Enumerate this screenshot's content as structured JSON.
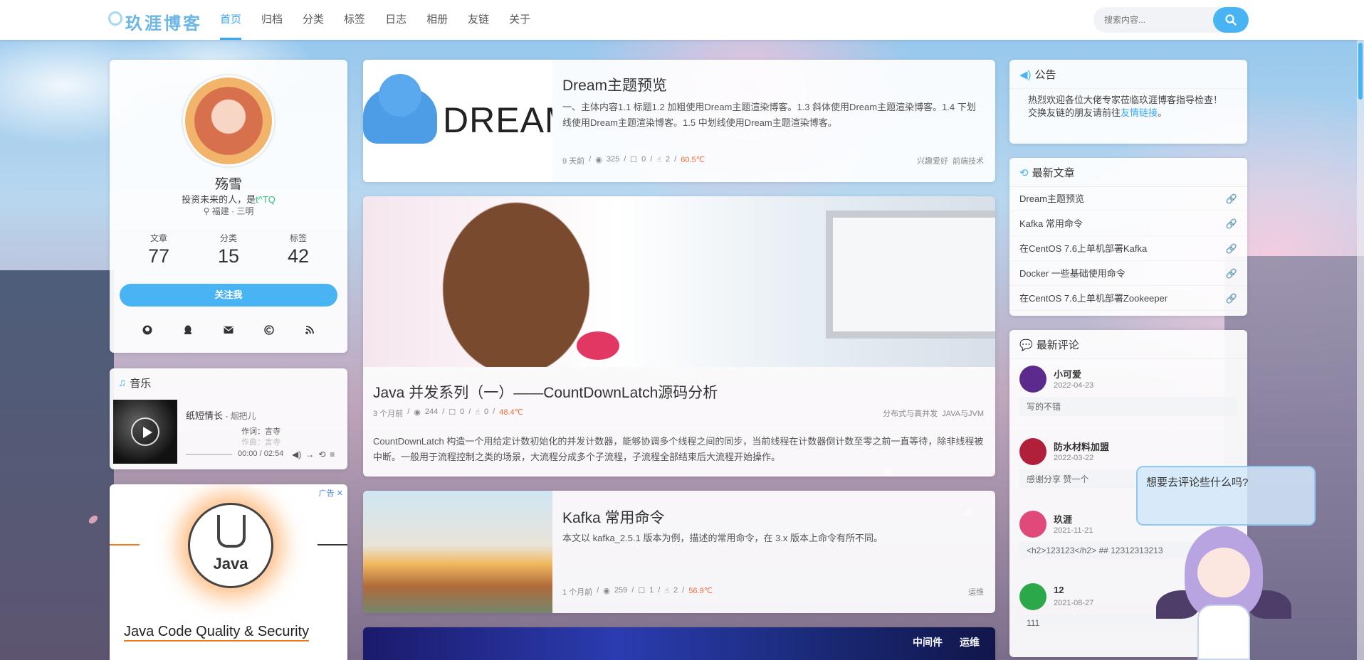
{
  "nav": {
    "logo": "玖涯博客",
    "items": [
      "首页",
      "归档",
      "分类",
      "标签",
      "日志",
      "相册",
      "友链",
      "关于"
    ],
    "active_index": 0,
    "search_placeholder": "搜索内容..."
  },
  "profile": {
    "name": "殇雪",
    "motto_prefix": "投资未来的人，是",
    "motto_highlight": "t^TQ",
    "location": "福建 · 三明",
    "stats": [
      {
        "label": "文章",
        "value": "77"
      },
      {
        "label": "分类",
        "value": "15"
      },
      {
        "label": "标签",
        "value": "42"
      }
    ],
    "follow_label": "关注我",
    "social_icons": [
      "github-icon",
      "qq-icon",
      "email-icon",
      "copyright-icon",
      "rss-icon"
    ]
  },
  "music": {
    "title": "音乐",
    "song": "纸短情长",
    "artist": " - 烟把儿",
    "lyric_current": "作词：言寺",
    "lyric_next": "作曲：言寺",
    "time": "00:00 / 02:54"
  },
  "ad": {
    "tag": "广告",
    "logo_text": "Java",
    "headline": "Java Code Quality & Security"
  },
  "posts": [
    {
      "title": "Dream主题预览",
      "summary": "一、主体内容1.1 标题1.2 加粗使用Dream主题渲染博客。1.3 斜体使用Dream主题渲染博客。1.4 下划线使用Dream主题渲染博客。1.5 中划线使用Dream主题渲染博客。",
      "thumb_text": "DREAM",
      "time": "9 天前",
      "views": "325",
      "comments": "0",
      "likes": "2",
      "temp": "60.5℃",
      "tags": [
        "兴趣爱好",
        "前端技术"
      ]
    },
    {
      "title": "Java 并发系列（一）——CountDownLatch源码分析",
      "summary": "CountDownLatch 构造一个用给定计数初始化的并发计数器，能够协调多个线程之间的同步，当前线程在计数器倒计数至零之前一直等待，除非线程被中断。一般用于流程控制之类的场景，大流程分成多个子流程，子流程全部结束后大流程开始操作。",
      "time": "3 个月前",
      "views": "244",
      "comments": "0",
      "likes": "0",
      "temp": "48.4℃",
      "tags": [
        "分布式与高并发",
        "JAVA与JVM"
      ]
    },
    {
      "title": "Kafka 常用命令",
      "summary": "本文以 kafka_2.5.1 版本为例，描述的常用命令，在 3.x 版本上命令有所不同。",
      "time": "1 个月前",
      "views": "259",
      "comments": "1",
      "likes": "2",
      "temp": "56.9℃",
      "tags": [
        "运维"
      ]
    },
    {
      "tags": [
        "中间件",
        "运维"
      ]
    }
  ],
  "notice": {
    "title": "公告",
    "line1": "热烈欢迎各位大佬专家莅临玖涯博客指导检查！",
    "line2_prefix": "交换友链的朋友请前往",
    "line2_link": "友情链接",
    "line2_suffix": "。"
  },
  "recent": {
    "title": "最新文章",
    "items": [
      "Dream主题预览",
      "Kafka 常用命令",
      "在CentOS 7.6上单机部署Kafka",
      "Docker 一些基础使用命令",
      "在CentOS 7.6上单机部署Zookeeper"
    ]
  },
  "comments": {
    "title": "最新评论",
    "items": [
      {
        "name": "小可爱",
        "date": "2022-04-23",
        "text": "写的不错",
        "color": "#5b2a8c"
      },
      {
        "name": "防水材料加盟",
        "date": "2022-03-22",
        "text": "感谢分享 赞一个",
        "color": "#b0203a"
      },
      {
        "name": "玖涯",
        "date": "2021-11-21",
        "text": "<h2>123123</h2> ## 12312313213",
        "color": "#e04a7a"
      },
      {
        "name": "12",
        "date": "2021-08-27",
        "text": "111",
        "color": "#2aa84a"
      }
    ]
  },
  "mascot_bubble": "想要去评论些什么吗?",
  "colors": {
    "accent": "#48b4f4",
    "temp": "#f06a3a",
    "highlight": "#36c07a"
  }
}
